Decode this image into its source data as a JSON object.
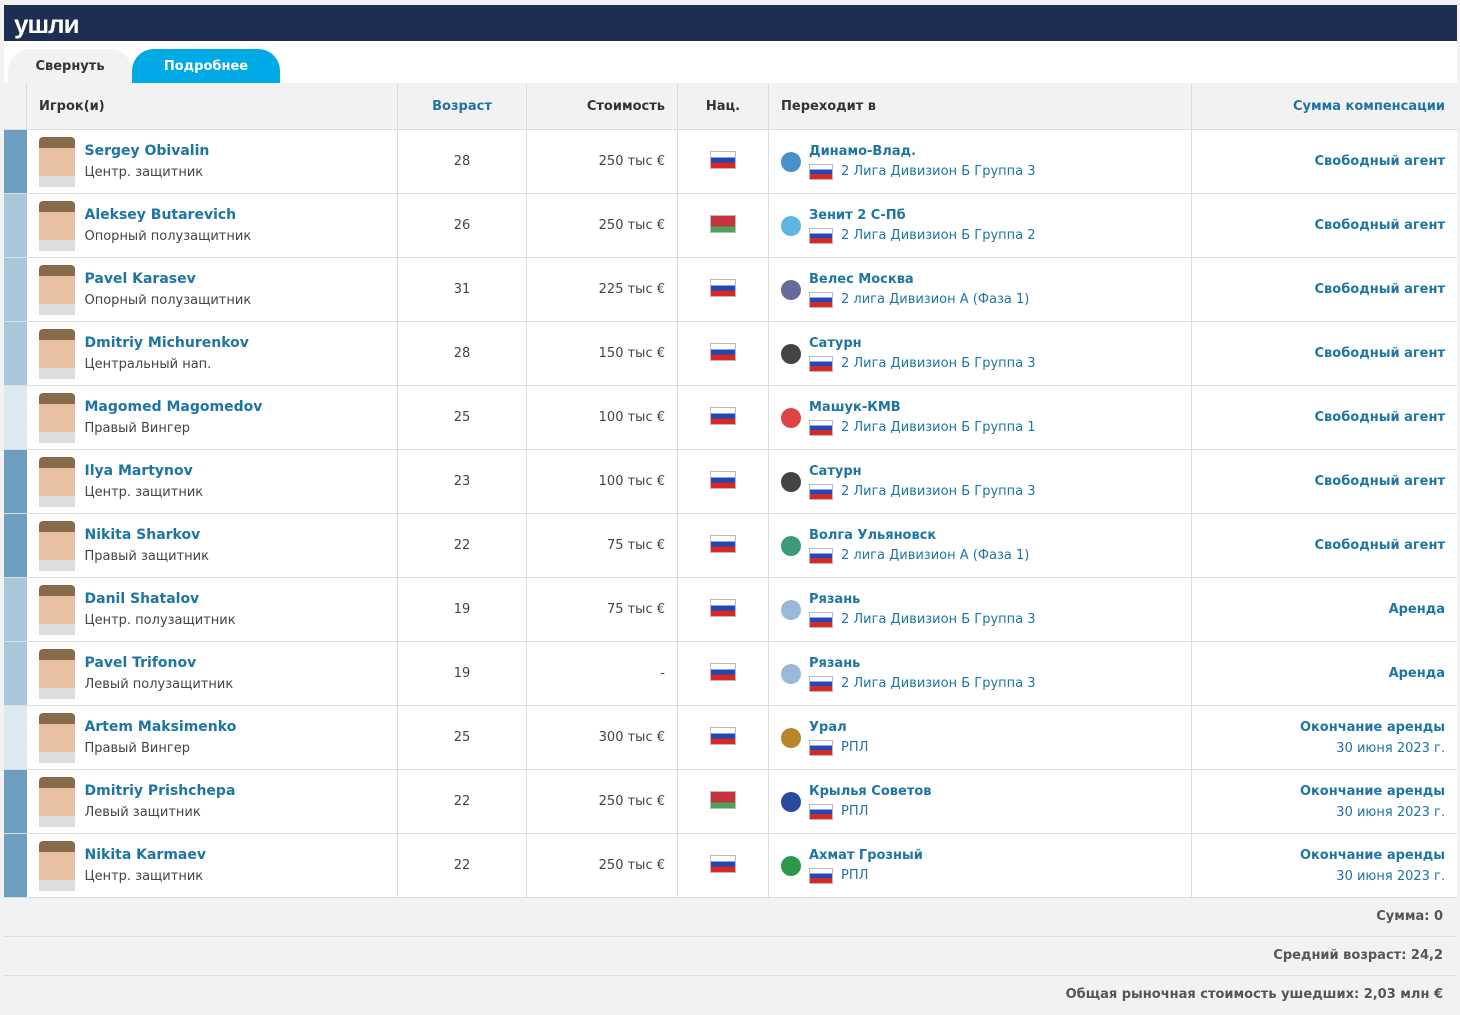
{
  "title": "ушли",
  "tabs": [
    "Свернуть",
    "Подробнее"
  ],
  "headers": {
    "player": "Игрок(и)",
    "age": "Возраст",
    "value": "Стоимость",
    "nat": "Нац.",
    "to": "Переходит в",
    "fee": "Сумма компенсации"
  },
  "rows": [
    {
      "name": "Sergey Obivalin",
      "pos": "Центр. защитник",
      "age": "28",
      "value": "250 тыс €",
      "nat": "ru",
      "club": "Динамо-Влад.",
      "league": "2 Лига Дивизион Б Группа 3",
      "fee": "Свободный агент",
      "bar": "dark",
      "crest": "#4a90c8"
    },
    {
      "name": "Aleksey Butarevich",
      "pos": "Опорный полузащитник",
      "age": "26",
      "value": "250 тыс €",
      "nat": "by",
      "club": "Зенит 2 С-Пб",
      "league": "2 Лига Дивизион Б Группа 2",
      "fee": "Свободный агент",
      "bar": "light",
      "crest": "#5bb6e0"
    },
    {
      "name": "Pavel Karasev",
      "pos": "Опорный полузащитник",
      "age": "31",
      "value": "225 тыс €",
      "nat": "ru",
      "club": "Велес Москва",
      "league": "2 лига Дивизион А (Фаза 1)",
      "fee": "Свободный агент",
      "bar": "light",
      "crest": "#6a6a9a"
    },
    {
      "name": "Dmitriy Michurenkov",
      "pos": "Центральный нап.",
      "age": "28",
      "value": "150 тыс €",
      "nat": "ru",
      "club": "Сатурн",
      "league": "2 Лига Дивизион Б Группа 3",
      "fee": "Свободный агент",
      "bar": "light",
      "crest": "#444"
    },
    {
      "name": "Magomed Magomedov",
      "pos": "Правый Вингер",
      "age": "25",
      "value": "100 тыс €",
      "nat": "ru",
      "club": "Машук-КМВ",
      "league": "2 Лига Дивизион Б Группа 1",
      "fee": "Свободный агент",
      "bar": "vlight",
      "crest": "#d44"
    },
    {
      "name": "Ilya Martynov",
      "pos": "Центр. защитник",
      "age": "23",
      "value": "100 тыс €",
      "nat": "ru",
      "club": "Сатурн",
      "league": "2 Лига Дивизион Б Группа 3",
      "fee": "Свободный агент",
      "bar": "dark",
      "crest": "#444"
    },
    {
      "name": "Nikita Sharkov",
      "pos": "Правый защитник",
      "age": "22",
      "value": "75 тыс €",
      "nat": "ru",
      "club": "Волга Ульяновск",
      "league": "2 лига Дивизион А (Фаза 1)",
      "fee": "Свободный агент",
      "bar": "dark",
      "crest": "#3a9a7a"
    },
    {
      "name": "Danil Shatalov",
      "pos": "Центр. полузащитник",
      "age": "19",
      "value": "75 тыс €",
      "nat": "ru",
      "club": "Рязань",
      "league": "2 Лига Дивизион Б Группа 3",
      "fee": "Аренда",
      "bar": "light",
      "crest": "#9ab8d8"
    },
    {
      "name": "Pavel Trifonov",
      "pos": "Левый полузащитник",
      "age": "19",
      "value": "-",
      "nat": "ru",
      "club": "Рязань",
      "league": "2 Лига Дивизион Б Группа 3",
      "fee": "Аренда",
      "bar": "light",
      "crest": "#9ab8d8"
    },
    {
      "name": "Artem Maksimenko",
      "pos": "Правый Вингер",
      "age": "25",
      "value": "300 тыс €",
      "nat": "ru",
      "club": "Урал",
      "league": "РПЛ",
      "fee": "Окончание аренды",
      "date": "30 июня 2023 г.",
      "bar": "vlight",
      "crest": "#b8862a"
    },
    {
      "name": "Dmitriy Prishchepa",
      "pos": "Левый защитник",
      "age": "22",
      "value": "250 тыс €",
      "nat": "by",
      "club": "Крылья Советов",
      "league": "РПЛ",
      "fee": "Окончание аренды",
      "date": "30 июня 2023 г.",
      "bar": "dark",
      "crest": "#2a4aa0"
    },
    {
      "name": "Nikita Karmaev",
      "pos": "Центр. защитник",
      "age": "22",
      "value": "250 тыс €",
      "nat": "ru",
      "club": "Ахмат Грозный",
      "league": "РПЛ",
      "fee": "Окончание аренды",
      "date": "30 июня 2023 г.",
      "bar": "dark",
      "crest": "#2a9a4a"
    }
  ],
  "footer": {
    "sum": "Сумма: 0",
    "avg_age": "Средний возраст: 24,2",
    "total_value": "Общая рыночная стоимость ушедших: 2,03 млн €"
  }
}
